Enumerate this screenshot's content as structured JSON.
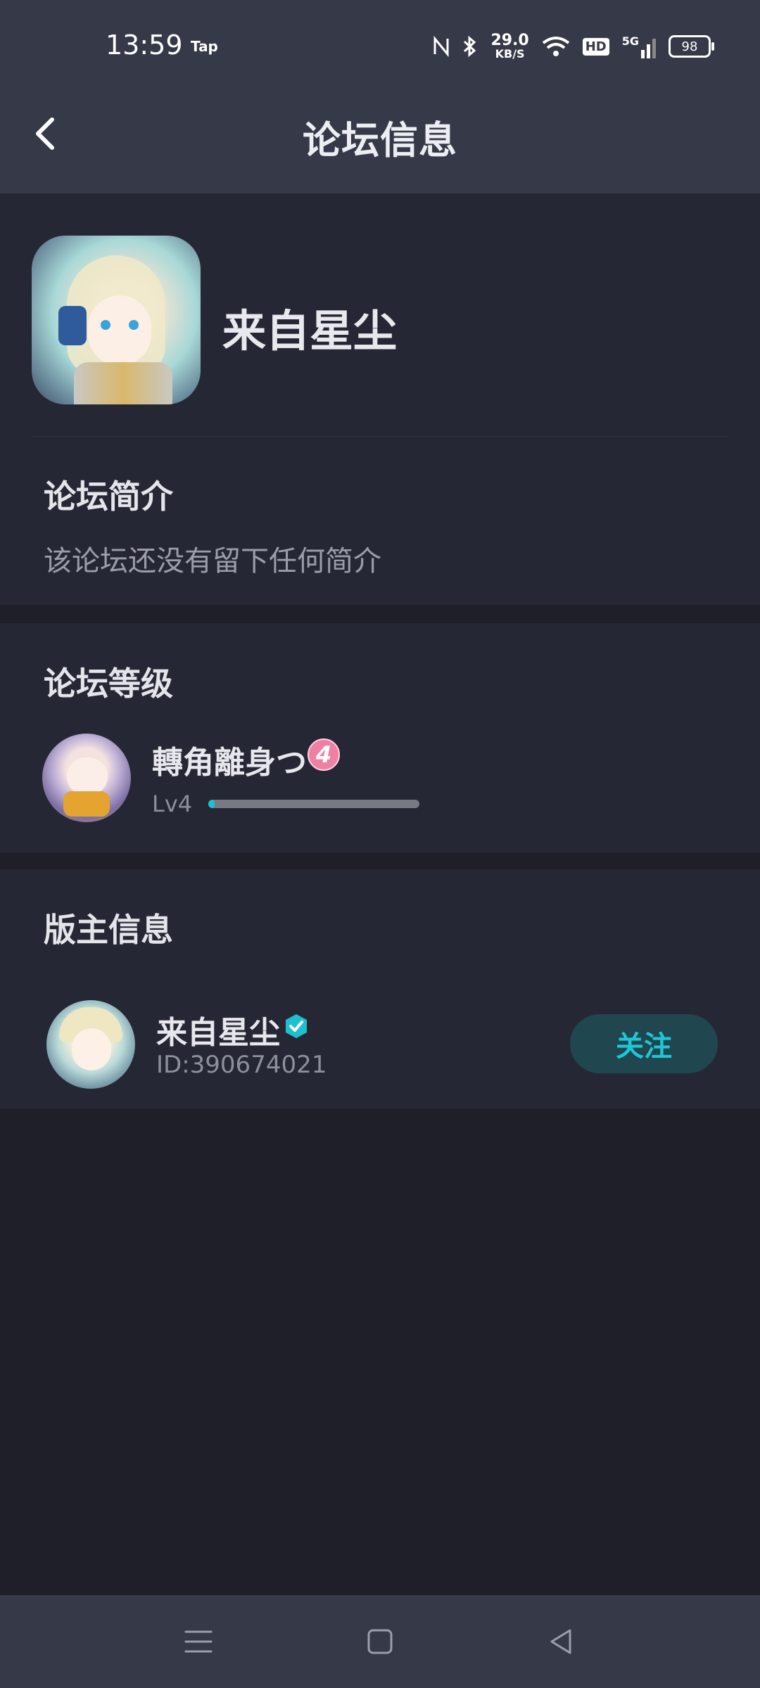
{
  "status_bar": {
    "time": "13:59",
    "carrier_label": "Tap",
    "network_speed_value": "29.0",
    "network_speed_unit": "KB/S",
    "hd_label": "HD",
    "signal_label": "5G",
    "battery_level": "98",
    "icons": [
      "nfc-icon",
      "bluetooth-icon",
      "wifi-icon",
      "hd-icon",
      "signal-5g-icon",
      "battery-icon"
    ]
  },
  "app_bar": {
    "title": "论坛信息",
    "back_icon": "back-chevron-icon"
  },
  "forum": {
    "name": "来自星尘",
    "intro_heading": "论坛简介",
    "intro_text": "该论坛还没有留下任何简介"
  },
  "level": {
    "heading": "论坛等级",
    "user_name": "轉角離身つ",
    "badge_number": "4",
    "level_label": "Lv4",
    "progress_fraction": 0.03
  },
  "moderator": {
    "heading": "版主信息",
    "name": "来自星尘",
    "id_text": "ID:390674021",
    "follow_label": "关注",
    "verified_icon": "verified-badge-icon"
  },
  "nav_bar": {
    "icons": [
      "menu-icon",
      "home-icon",
      "back-triangle-icon"
    ]
  },
  "colors": {
    "accent": "#19c3d1",
    "background": "#1f1f29",
    "card": "#262734",
    "bar": "#363a48",
    "badge_pink": "#f07fa4"
  }
}
